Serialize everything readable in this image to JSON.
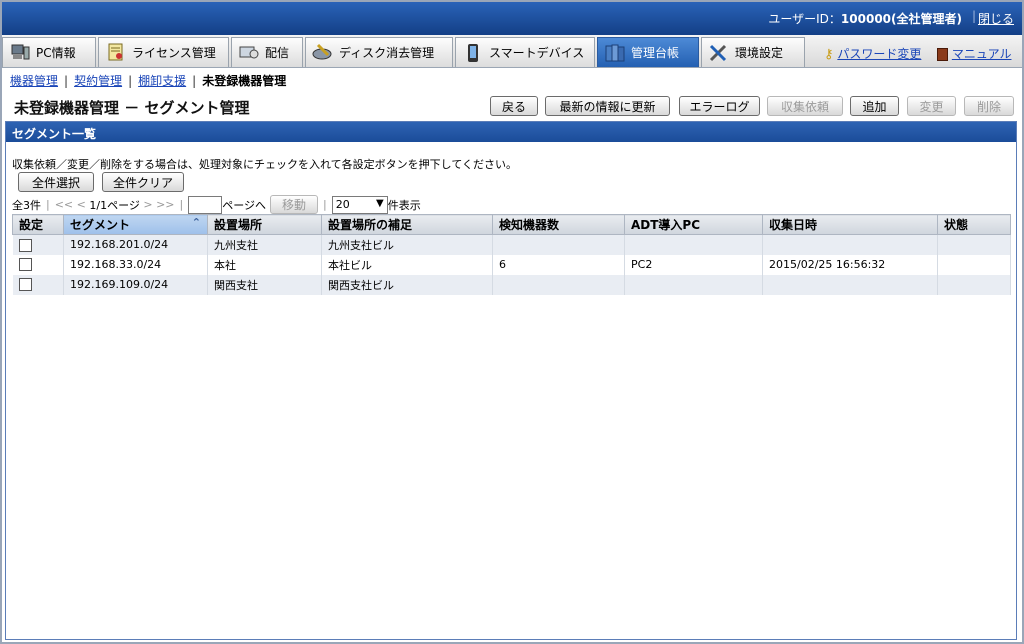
{
  "header": {
    "user_label": "ユーザーID：",
    "user_value": "100000(全社管理者)",
    "close_label": "閉じる"
  },
  "tabs": [
    {
      "label": "PC情報",
      "icon": "pc-icon"
    },
    {
      "label": "ライセンス管理",
      "icon": "license-icon"
    },
    {
      "label": "配信",
      "icon": "distribution-icon"
    },
    {
      "label": "ディスク消去管理",
      "icon": "disk-erase-icon"
    },
    {
      "label": "スマートデバイス",
      "icon": "smartphone-icon"
    },
    {
      "label": "管理台帳",
      "icon": "ledger-icon",
      "active": true
    },
    {
      "label": "環境設定",
      "icon": "tools-icon"
    }
  ],
  "top_links": {
    "password_change": "パスワード変更",
    "manual": "マニュアル"
  },
  "breadcrumb": {
    "items": [
      "機器管理",
      "契約管理",
      "棚卸支援"
    ],
    "current": "未登録機器管理"
  },
  "page_title": "未登録機器管理 － セグメント管理",
  "toolbar": {
    "back": "戻る",
    "refresh": "最新の情報に更新",
    "error_log": "エラーログ",
    "collect_request": "収集依頼",
    "add": "追加",
    "modify": "変更",
    "delete": "削除"
  },
  "section_title": "セグメント一覧",
  "instruction": "収集依頼／変更／削除をする場合は、処理対象にチェックを入れて各設定ボタンを押下してください。",
  "select_all": "全件選択",
  "clear_all": "全件クリア",
  "pager": {
    "total": "全3件",
    "first": "<<",
    "prev": "<",
    "page_info": "1/1ページ",
    "next": ">",
    "last": ">>",
    "page_to": "ページへ",
    "move": "移動",
    "per_page": "20",
    "per_page_suffix": "件表示"
  },
  "table": {
    "columns": [
      "設定",
      "セグメント",
      "設置場所",
      "設置場所の補足",
      "検知機器数",
      "ADT導入PC",
      "収集日時",
      "状態"
    ],
    "rows": [
      {
        "segment": "192.168.201.0/24",
        "location": "九州支社",
        "location_note": "九州支社ビル",
        "detected": "",
        "adt_pc": "",
        "collected_at": "",
        "status": ""
      },
      {
        "segment": "192.168.33.0/24",
        "location": "本社",
        "location_note": "本社ビル",
        "detected": "6",
        "adt_pc": "PC2",
        "collected_at": "2015/02/25 16:56:32",
        "status": ""
      },
      {
        "segment": "192.169.109.0/24",
        "location": "関西支社",
        "location_note": "関西支社ビル",
        "detected": "",
        "adt_pc": "",
        "collected_at": "",
        "status": ""
      }
    ]
  }
}
